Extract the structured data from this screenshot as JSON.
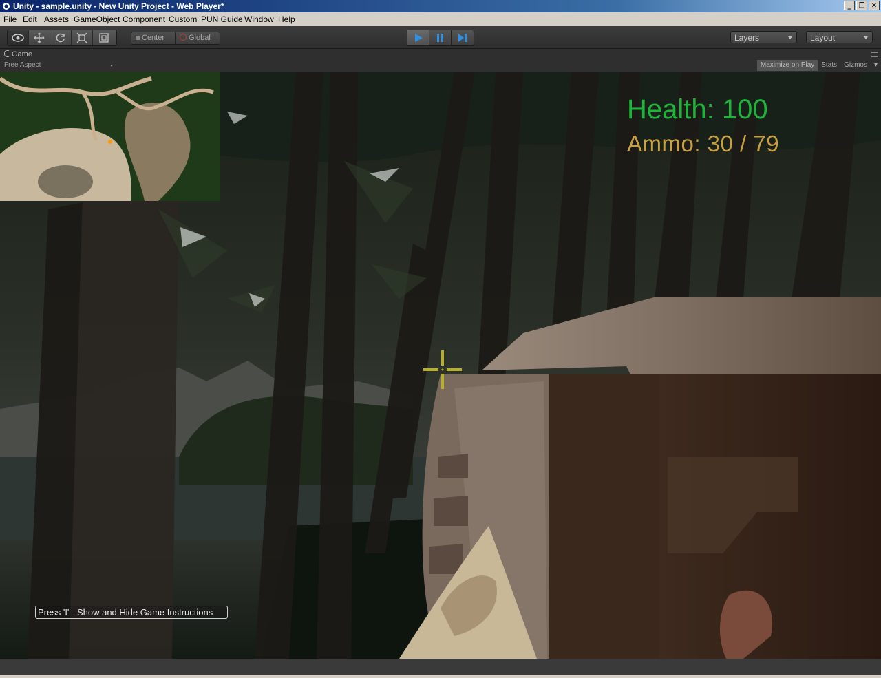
{
  "window": {
    "title": "Unity - sample.unity - New Unity Project - Web Player*",
    "buttons": [
      "minimize",
      "restore",
      "close"
    ]
  },
  "menu": [
    "File",
    "Edit",
    "Assets",
    "GameObject",
    "Component",
    "Custom",
    "PUN Guide",
    "Window",
    "Help"
  ],
  "toolbar": {
    "tools": [
      "hand-icon",
      "move-icon",
      "rotate-icon",
      "scale-icon",
      "rect-icon"
    ],
    "pivot_center": "Center",
    "pivot_global": "Global",
    "play_controls": [
      "play-icon",
      "pause-icon",
      "step-icon"
    ],
    "layers_label": "Layers",
    "layout_label": "Layout"
  },
  "game_panel": {
    "tab_label": "Game",
    "aspect": "Free Aspect",
    "maximize_on_play": "Maximize on Play",
    "stats": "Stats",
    "gizmos": "Gizmos"
  },
  "hud": {
    "health": "Health: 100",
    "ammo": "Ammo: 30 / 79",
    "hint": "Press 'I' - Show and Hide Game Instructions",
    "colors": {
      "health": "#1fb33a",
      "ammo": "#c8a040",
      "crosshair": "#b8b020"
    }
  }
}
